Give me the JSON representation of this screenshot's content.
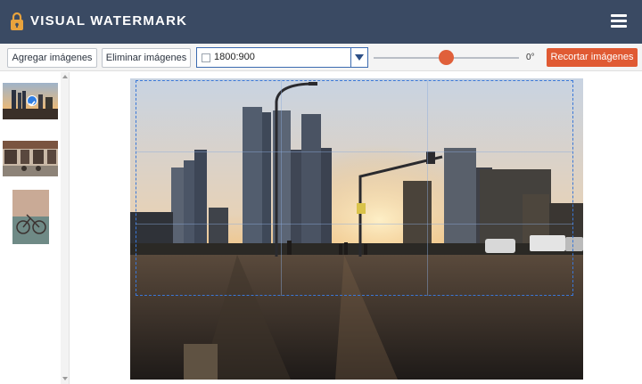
{
  "header": {
    "title": "VISUAL WATERMARK",
    "logo_icon": "padlock-icon",
    "menu_icon": "hamburger-menu-icon"
  },
  "toolbar": {
    "add_images_label": "Agregar imágenes",
    "delete_images_label": "Eliminar imágenes",
    "aspect_ratio_value": "1800:900",
    "rotation_angle": "0°",
    "crop_images_label": "Recortar imágenes"
  },
  "thumbnails": [
    {
      "name": "city-sunset",
      "selected": true
    },
    {
      "name": "street-cafe",
      "selected": false
    },
    {
      "name": "bicycle-wall",
      "selected": false
    }
  ],
  "colors": {
    "header_bg": "#3a4a63",
    "accent": "#e05a33",
    "crop_border": "#3a78d8",
    "select_border": "#3c6bb0",
    "selected_badge": "#2f7de1"
  }
}
